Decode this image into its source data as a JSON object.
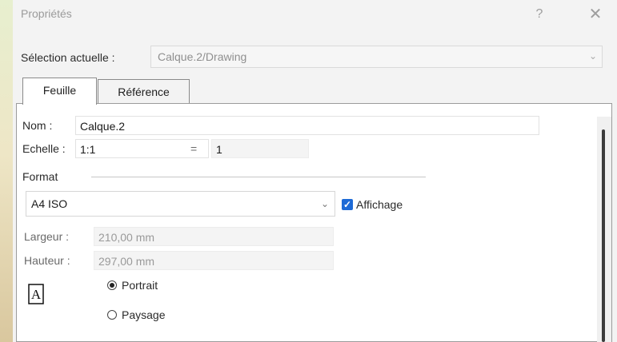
{
  "window": {
    "title": "Propriétés",
    "help_glyph": "?",
    "close_glyph": "✕"
  },
  "selection": {
    "label": "Sélection actuelle :",
    "value": "Calque.2/Drawing"
  },
  "tabs": [
    {
      "label": "Feuille",
      "active": true
    },
    {
      "label": "Référence",
      "active": false
    }
  ],
  "sheet": {
    "name_label": "Nom :",
    "name_value": "Calque.2",
    "scale_label": "Echelle :",
    "scale_value": "1:1",
    "equals": "=",
    "scale_result": "1",
    "format_group_label": "Format",
    "format_value": "A4 ISO",
    "display_label": "Affichage",
    "display_checked": true,
    "width_label": "Largeur :",
    "width_value": "210,00 mm",
    "height_label": "Hauteur :",
    "height_value": "297,00 mm",
    "orientation_options": [
      {
        "label": "Portrait",
        "selected": true
      },
      {
        "label": "Paysage",
        "selected": false
      }
    ]
  },
  "colors": {
    "accent": "#1d6ad6",
    "background": "#e9efd8"
  }
}
